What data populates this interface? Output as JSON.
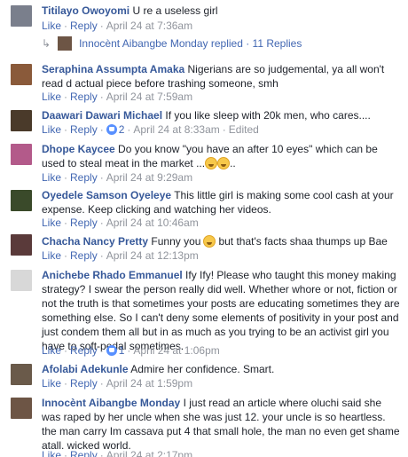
{
  "common": {
    "like": "Like",
    "reply": "Reply",
    "dot": "·",
    "edited": "Edited"
  },
  "replies_preview": {
    "text": "Innocènt Aibangbe Monday replied · 11 Replies"
  },
  "comments": [
    {
      "author": "Titilayo Owoyomi",
      "text": "U re a useless girl",
      "time": "April 24 at 7:36am",
      "avatar_color": "#7a7f8c"
    },
    {
      "author": "Seraphina Assumpta Amaka",
      "text": "Nigerians are so judgemental, ya all won't read d actual piece before trashing someone, smh",
      "time": "April 24 at 7:59am",
      "avatar_color": "#8a5a3a"
    },
    {
      "author": "Daawari Dawari Michael",
      "text": "If you like sleep with 20k men, who cares....",
      "time": "April 24 at 8:33am",
      "reaction_count": "2",
      "avatar_color": "#4a3a2a"
    },
    {
      "author": "Dhope Kaycee",
      "text": "Do you know \"you have an after 10 eyes\" which can be used to steal meat in the market ...",
      "text_suffix": "..",
      "time": "April 24 at 9:29am",
      "avatar_color": "#b35a8a"
    },
    {
      "author": "Oyedele Samson Oyeleye",
      "text": "This little girl is making some cool cash at your expense. Keep clicking and watching her videos.",
      "time": "April 24 at 10:46am",
      "avatar_color": "#3a4a2a"
    },
    {
      "author": "Chacha Nancy Pretty",
      "text_pre": "Funny you",
      "text_post": "but that's facts shaa thumps up Bae",
      "time": "April 24 at 12:13pm",
      "avatar_color": "#5a3a3a"
    },
    {
      "author": "Anichebe Rhado Emmanuel",
      "text": "Ify Ify! Please who taught this money making strategy? I swear the person really did well. Whether whore or not, fiction or not the truth is that sometimes your posts are educating sometimes they are something else. So I can't deny some elements of positivity in your post and just condem them all but in as much as you trying to be an activist girl you have to soft-pedal sometimes.",
      "time": "April 24 at 1:06pm",
      "reaction_count": "1",
      "avatar_color": "#d8d8d8"
    },
    {
      "author": "Afolabi Adekunle",
      "text": "Admire her confidence. Smart.",
      "time": "April 24 at 1:59pm",
      "avatar_color": "#6a5a4a"
    },
    {
      "author": "Innocènt Aibangbe Monday",
      "text": "I just read an article where oluchi said she was raped by her uncle when she was just 12. your uncle is so heartless. the man carry Im cassava put 4 that small hole, the man no even get shame atall. wicked world.",
      "time": "April 24 at 2:17pm",
      "avatar_color": "#6d5545"
    }
  ]
}
